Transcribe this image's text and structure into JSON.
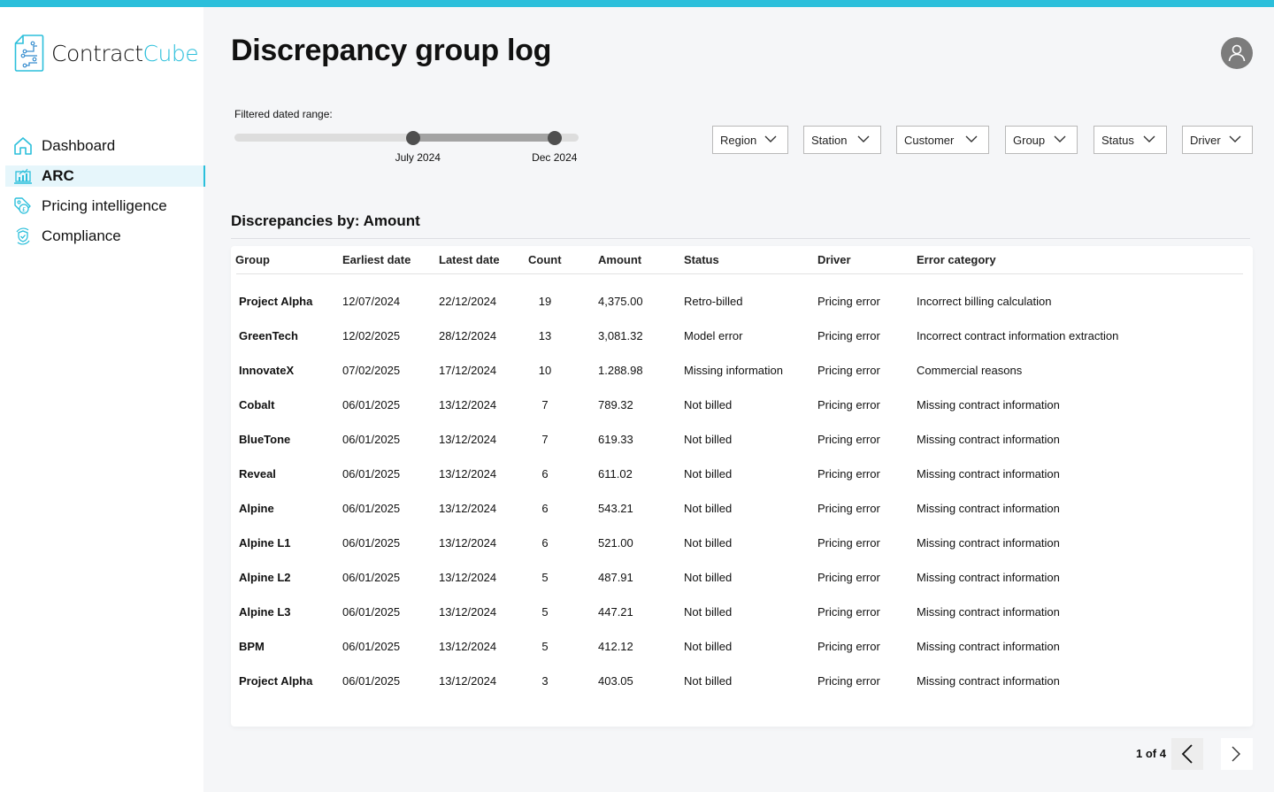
{
  "app": {
    "brand_part1": "Contract",
    "brand_part2": "Cube",
    "accent_color": "#2bbfdb"
  },
  "sidebar": {
    "items": [
      {
        "label": "Dashboard",
        "icon": "home-icon",
        "active": false
      },
      {
        "label": "ARC",
        "icon": "chart-laptop-icon",
        "active": true
      },
      {
        "label": "Pricing intelligence",
        "icon": "price-tag-pound-icon",
        "active": false
      },
      {
        "label": "Compliance",
        "icon": "shield-check-icon",
        "active": false
      }
    ]
  },
  "header": {
    "title": "Discrepancy group log",
    "avatar_icon": "user-icon"
  },
  "date_range": {
    "label": "Filtered dated range:",
    "start_label": "July 2024",
    "end_label": "Dec 2024",
    "start_fraction": 0.52,
    "end_fraction": 0.93
  },
  "filters": [
    {
      "label": "Region"
    },
    {
      "label": "Station"
    },
    {
      "label": "Customer"
    },
    {
      "label": "Group"
    },
    {
      "label": "Status"
    },
    {
      "label": "Driver"
    }
  ],
  "section": {
    "title": "Discrepancies by: Amount"
  },
  "table": {
    "columns": [
      "Group",
      "Earliest date",
      "Latest date",
      "Count",
      "Amount",
      "Status",
      "Driver",
      "Error category"
    ],
    "rows": [
      {
        "group": "Project Alpha",
        "earliest": "12/07/2024",
        "latest": "22/12/2024",
        "count": "19",
        "amount": "4,375.00",
        "status": "Retro-billed",
        "driver": "Pricing error",
        "category": "Incorrect billing calculation"
      },
      {
        "group": "GreenTech",
        "earliest": "12/02/2025",
        "latest": "28/12/2024",
        "count": "13",
        "amount": "3,081.32",
        "status": "Model error",
        "driver": "Pricing error",
        "category": "Incorrect contract information extraction"
      },
      {
        "group": "InnovateX",
        "earliest": "07/02/2025",
        "latest": "17/12/2024",
        "count": "10",
        "amount": "1.288.98",
        "status": "Missing information",
        "driver": "Pricing error",
        "category": "Commercial reasons"
      },
      {
        "group": "Cobalt",
        "earliest": "06/01/2025",
        "latest": "13/12/2024",
        "count": "7",
        "amount": "789.32",
        "status": "Not billed",
        "driver": "Pricing error",
        "category": "Missing contract information"
      },
      {
        "group": "BlueTone",
        "earliest": "06/01/2025",
        "latest": "13/12/2024",
        "count": "7",
        "amount": "619.33",
        "status": "Not billed",
        "driver": "Pricing error",
        "category": "Missing contract information"
      },
      {
        "group": "Reveal",
        "earliest": "06/01/2025",
        "latest": "13/12/2024",
        "count": "6",
        "amount": "611.02",
        "status": "Not billed",
        "driver": "Pricing error",
        "category": "Missing contract information"
      },
      {
        "group": "Alpine",
        "earliest": "06/01/2025",
        "latest": "13/12/2024",
        "count": "6",
        "amount": "543.21",
        "status": "Not billed",
        "driver": "Pricing error",
        "category": "Missing contract information"
      },
      {
        "group": "Alpine L1",
        "earliest": "06/01/2025",
        "latest": "13/12/2024",
        "count": "6",
        "amount": "521.00",
        "status": "Not billed",
        "driver": "Pricing error",
        "category": "Missing contract information"
      },
      {
        "group": "Alpine L2",
        "earliest": "06/01/2025",
        "latest": "13/12/2024",
        "count": "5",
        "amount": "487.91",
        "status": "Not billed",
        "driver": "Pricing error",
        "category": "Missing contract information"
      },
      {
        "group": "Alpine L3",
        "earliest": "06/01/2025",
        "latest": "13/12/2024",
        "count": "5",
        "amount": "447.21",
        "status": "Not billed",
        "driver": "Pricing error",
        "category": "Missing contract information"
      },
      {
        "group": "BPM",
        "earliest": "06/01/2025",
        "latest": "13/12/2024",
        "count": "5",
        "amount": "412.12",
        "status": "Not billed",
        "driver": "Pricing error",
        "category": "Missing contract information"
      },
      {
        "group": "Project Alpha",
        "earliest": "06/01/2025",
        "latest": "13/12/2024",
        "count": "3",
        "amount": "403.05",
        "status": "Not billed",
        "driver": "Pricing error",
        "category": "Missing contract information"
      }
    ]
  },
  "pagination": {
    "text": "1 of 4",
    "prev_icon": "chevron-left-icon",
    "next_icon": "chevron-right-icon"
  }
}
